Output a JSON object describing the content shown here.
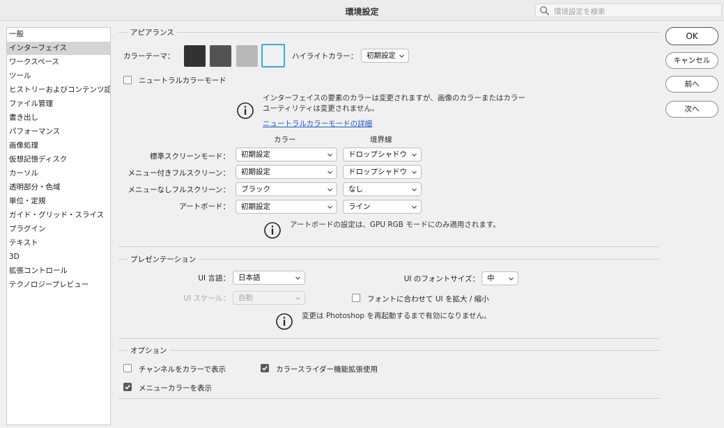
{
  "window": {
    "title": "環境設定"
  },
  "search": {
    "placeholder": "環境設定を検索",
    "icon": "search-icon"
  },
  "sidebar": {
    "items": [
      {
        "label": "一般"
      },
      {
        "label": "インターフェイス"
      },
      {
        "label": "ワークスペース"
      },
      {
        "label": "ツール"
      },
      {
        "label": "ヒストリーおよびコンテンツ認…"
      },
      {
        "label": "ファイル管理"
      },
      {
        "label": "書き出し"
      },
      {
        "label": "パフォーマンス"
      },
      {
        "label": "画像処理"
      },
      {
        "label": "仮想記憶ディスク"
      },
      {
        "label": "カーソル"
      },
      {
        "label": "透明部分・色域"
      },
      {
        "label": "単位・定規"
      },
      {
        "label": "ガイド・グリッド・スライス"
      },
      {
        "label": "プラグイン"
      },
      {
        "label": "テキスト"
      },
      {
        "label": "3D"
      },
      {
        "label": "拡張コントロール"
      },
      {
        "label": "テクノロジープレビュー"
      }
    ],
    "selected_label": "インターフェイス"
  },
  "appearance": {
    "title": "アピアランス",
    "color_theme_label": "カラーテーマ：",
    "themes": [
      {
        "name": "darkest",
        "color": "#323232"
      },
      {
        "name": "dark",
        "color": "#535353"
      },
      {
        "name": "medium",
        "color": "#b8b8b8"
      },
      {
        "name": "light",
        "color": "#f0f0f0",
        "selected": true
      }
    ],
    "highlight_label": "ハイライトカラー：",
    "highlight_value": "初期設定",
    "neutral_mode_label": "ニュートラルカラーモード",
    "neutral_mode_checked": false,
    "info_line1": "インターフェイスの要素のカラーは変更されますが、画像のカラーまたはカラー",
    "info_line2": "ユーティリティは変更されません。",
    "info_link": "ニュートラルカラーモードの詳細",
    "col_color": "カラー",
    "col_border": "境界線",
    "rows": [
      {
        "label": "標準スクリーンモード：",
        "color": "初期設定",
        "border": "ドロップシャドウ"
      },
      {
        "label": "メニュー付きフルスクリーン：",
        "color": "初期設定",
        "border": "ドロップシャドウ"
      },
      {
        "label": "メニューなしフルスクリーン：",
        "color": "ブラック",
        "border": "なし"
      },
      {
        "label": "アートボード：",
        "color": "初期設定",
        "border": "ライン"
      }
    ],
    "artboard_note": "アートボードの設定は、GPU RGB モードにのみ適用されます。"
  },
  "presentation": {
    "title": "プレゼンテーション",
    "ui_language_label": "UI 言語：",
    "ui_language_value": "日本語",
    "ui_font_size_label": "UI のフォントサイズ：",
    "ui_font_size_value": "中",
    "ui_scale_label": "UI スケール：",
    "ui_scale_value": "自動",
    "scale_with_font_label": "フォントに合わせて UI を拡大 / 縮小",
    "scale_with_font_checked": false,
    "restart_note": "変更は Photoshop を再起動するまで有効になりません。"
  },
  "options": {
    "title": "オプション",
    "show_channels_color_label": "チャンネルをカラーで表示",
    "show_channels_color_checked": false,
    "dynamic_color_sliders_label": "カラースライダー機能拡張使用",
    "dynamic_color_sliders_checked": true,
    "show_menu_colors_label": "メニューカラーを表示",
    "show_menu_colors_checked": true
  },
  "buttons": {
    "ok": "OK",
    "cancel": "キャンセル",
    "prev": "前へ",
    "next": "次へ"
  }
}
